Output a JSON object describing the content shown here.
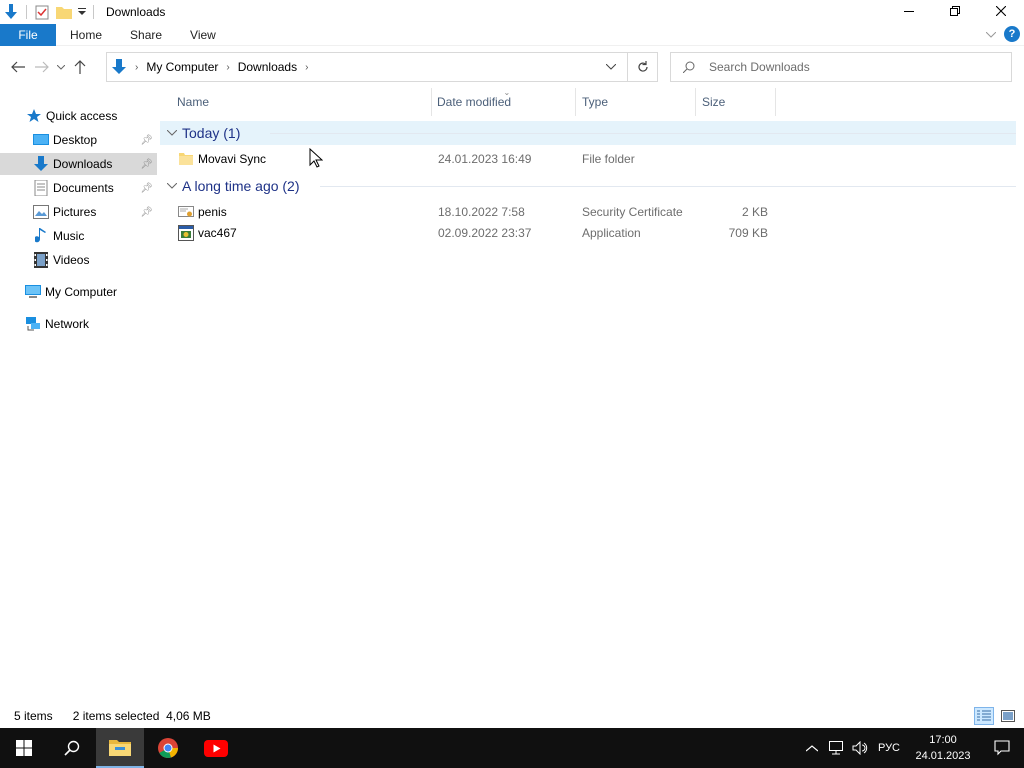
{
  "window": {
    "title": "Downloads"
  },
  "ribbon": {
    "file": "File",
    "tabs": [
      "Home",
      "Share",
      "View"
    ]
  },
  "address": {
    "crumbs": [
      "My Computer",
      "Downloads"
    ]
  },
  "search": {
    "placeholder": "Search Downloads"
  },
  "sidebar": {
    "items": [
      {
        "label": "Quick access",
        "icon": "star-icon"
      },
      {
        "label": "Desktop",
        "icon": "desktop-icon"
      },
      {
        "label": "Downloads",
        "icon": "download-icon"
      },
      {
        "label": "Documents",
        "icon": "documents-icon"
      },
      {
        "label": "Pictures",
        "icon": "pictures-icon"
      },
      {
        "label": "Music",
        "icon": "music-icon"
      },
      {
        "label": "Videos",
        "icon": "videos-icon"
      },
      {
        "label": "My Computer",
        "icon": "computer-icon"
      },
      {
        "label": "Network",
        "icon": "network-icon"
      }
    ]
  },
  "columns": {
    "name": "Name",
    "date": "Date modified",
    "type": "Type",
    "size": "Size"
  },
  "groups": [
    {
      "label": "Today (1)",
      "rows": [
        {
          "name": "Movavi Sync",
          "date": "24.01.2023 16:49",
          "type": "File folder",
          "size": "",
          "icon": "folder-icon"
        }
      ]
    },
    {
      "label": "A long time ago (2)",
      "rows": [
        {
          "name": "penis",
          "date": "18.10.2022 7:58",
          "type": "Security Certificate",
          "size": "2 KB",
          "icon": "certificate-icon"
        },
        {
          "name": "vac467",
          "date": "02.09.2022 23:37",
          "type": "Application",
          "size": "709 KB",
          "icon": "application-icon"
        }
      ]
    }
  ],
  "status": {
    "items": "5 items",
    "selected": "2 items selected  4,06 MB"
  },
  "taskbar": {
    "lang": "РУС",
    "time": "17:00",
    "date": "24.01.2023"
  },
  "colors": {
    "accent": "#1979ca",
    "group_text": "#1e3287",
    "selected_bg": "#d9d9d9",
    "hover_bg": "#e5f3fb",
    "taskbar": "#101010"
  }
}
